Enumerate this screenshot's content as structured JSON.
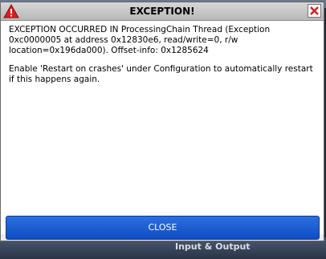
{
  "dialog": {
    "title": "EXCEPTION!",
    "message_1": "EXCEPTION OCCURRED IN ProcessingChain Thread (Exception 0xc0000005 at address 0x12830e6, read/write=0, r/w location=0x196da000). Offset-info: 0x1285624",
    "message_2": "Enable 'Restart on crashes' under Configuration to automatically restart if this happens again.",
    "close_button_label": "CLOSE"
  },
  "background": {
    "panel_label": "Input & Output"
  },
  "colors": {
    "accent": "#1a5ad4",
    "warning": "#cc2222",
    "close_x": "#cc2222"
  },
  "icons": {
    "title_left": "warning-icon",
    "title_right": "close-icon"
  }
}
